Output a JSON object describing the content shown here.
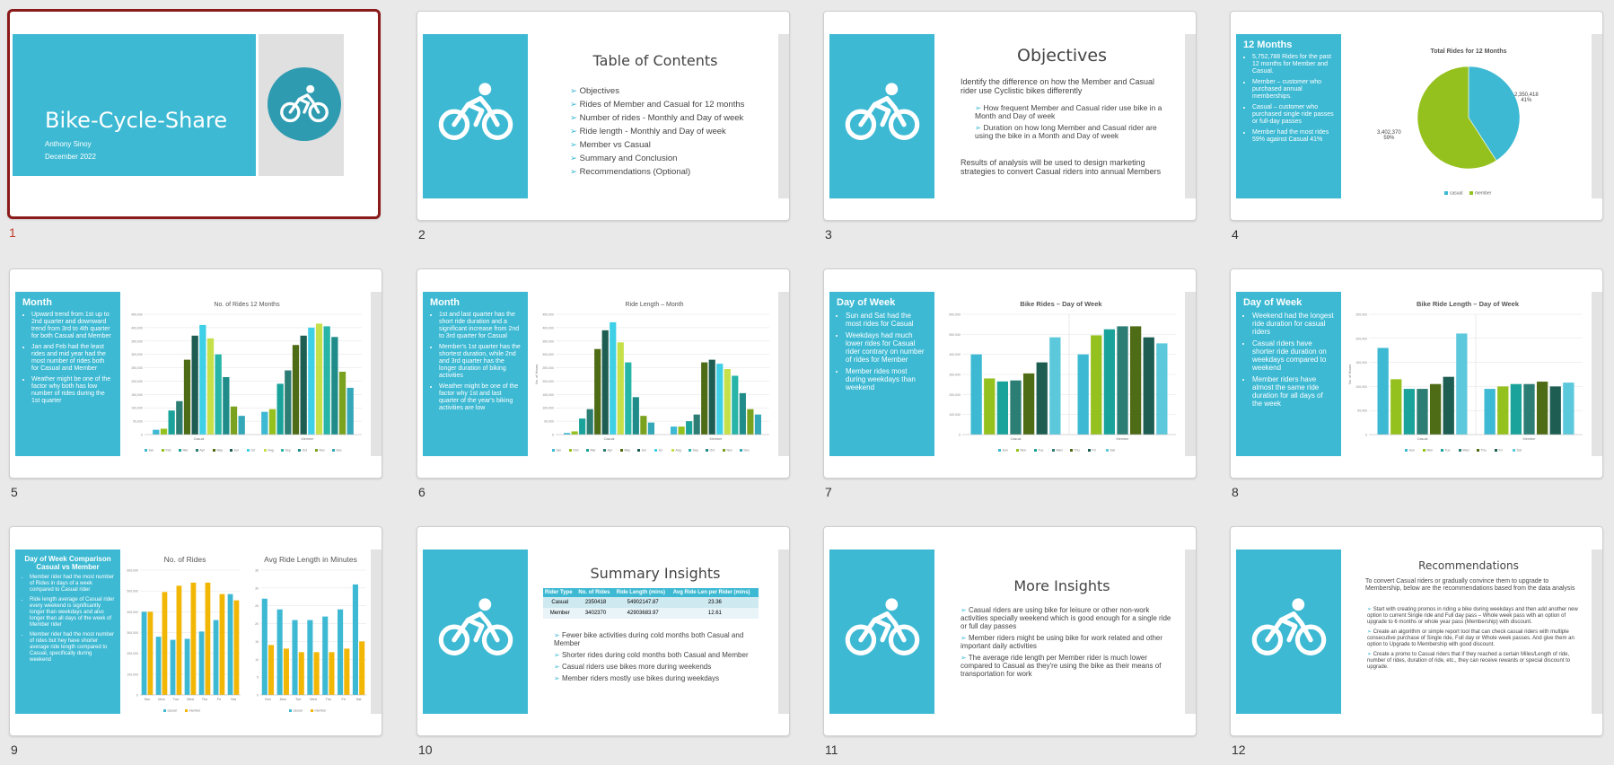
{
  "slide_numbers": [
    "1",
    "2",
    "3",
    "4",
    "5",
    "6",
    "7",
    "8",
    "9",
    "10",
    "11",
    "12"
  ],
  "slide1": {
    "title": "Bike-Cycle-Share",
    "author": "Anthony Sinoy",
    "date": "December 2022"
  },
  "slide2": {
    "title": "Table of Contents",
    "items": [
      "Objectives",
      "Rides of Member and Casual for 12 months",
      "Number of rides - Monthly and Day of week",
      "Ride length - Monthly and Day of week",
      "Member vs Casual",
      "Summary and Conclusion",
      "Recommendations (Optional)"
    ]
  },
  "slide3": {
    "title": "Objectives",
    "intro": "Identify the difference on how the Member and Casual rider use Cyclistic bikes differently",
    "bullets": [
      "How frequent Member and Casual rider use bike in a Month and Day of week",
      "Duration on how long Member and Casual rider are using the bike in a Month and Day of week"
    ],
    "outro": "Results of analysis will be used to design marketing strategies to convert Casual riders into annual Members"
  },
  "slide4": {
    "panel_title": "12 Months",
    "bullets": [
      "5,752,788 Rides for the past 12 months for Member and Casual.",
      "Member – customer who purchased annual memberships.",
      "Casual – customer who purchased single ride passes or full-day passes",
      "Member had the most rides 59% against Casual 41%"
    ],
    "label_casual_value": "2,350,418",
    "label_casual_pct": "41%",
    "label_member_value": "3,402,370",
    "label_member_pct": "59%"
  },
  "slide5": {
    "panel_title": "Month",
    "bullets": [
      "Upward trend from 1st up to 2nd quarter and downward trend from 3rd to 4th quarter for both Casual and Member",
      "Jan and Feb had the least rides and mid year had the most number of rides both for Casual and Member",
      "Weather might be one of the factor why both has low number of rides during the 1st quarter"
    ]
  },
  "slide6": {
    "panel_title": "Month",
    "bullets": [
      "1st and last quarter has the short ride duration and a significant increase from 2nd to 3rd quarter for Casual",
      "Member's 1st quarter has the shortest duration, while 2nd and 3rd quarter has the longer duration of biking activities",
      "Weather might be one of the factor why 1st and last quarter of the year's biking activities are low"
    ]
  },
  "slide7": {
    "panel_title": "Day of Week",
    "bullets": [
      "Sun and Sat had the most rides for Casual",
      "Weekdays had much lower rides for Casual rider contrary on number of rides for Member",
      "Member rides most during weekdays than weekend"
    ]
  },
  "slide8": {
    "panel_title": "Day of Week",
    "bullets": [
      "Weekend had the longest ride duration for casual riders",
      "Casual riders have shorter ride duration on weekdays compared to weekend",
      "Member riders have almost the same ride duration for all days of the week"
    ]
  },
  "slide9": {
    "panel_title": "Day of Week Comparison Casual vs Member",
    "bullets": [
      "Member rider had the most number of Rides in days of a week compared to Casual rider",
      "Ride length average of Casual rider every weekend is significantly longer than weekdays and also longer than all days of the week of Member rider",
      "Member rider had the most number of rides but hey have shorter average ride length compared to Casual, specifically during weekend"
    ]
  },
  "slide10": {
    "title": "Summary Insights",
    "table": {
      "headers": [
        "Rider Type",
        "No. of Rides",
        "Ride Length (mins)",
        "Avg Ride Len per Rider (mins)"
      ],
      "rows": [
        [
          "Casual",
          "2350418",
          "54902147.87",
          "23.36"
        ],
        [
          "Member",
          "3402370",
          "42903683.97",
          "12.61"
        ]
      ]
    },
    "bullets": [
      "Fewer bike activities during cold months both Casual and Member",
      "Shorter rides during cold months both Casual and Member",
      "Casual riders use bikes more during weekends",
      "Member riders mostly use bikes during weekdays"
    ]
  },
  "slide11": {
    "title": "More Insights",
    "bullets": [
      "Casual riders are using bike for leisure or other non-work activities specially weekend which is good enough for a single ride or full day passes",
      "Member riders might be using bike for work related and other important daily activities",
      "The average ride length per Member rider is much lower compared to Casual as they're using the bike as their means of transportation for work"
    ]
  },
  "slide12": {
    "title": "Recommendations",
    "intro": "To convert Casual riders or gradually convince them to upgrade to Membership, below are the recommendations based from the data analysis",
    "bullets": [
      "Start with creating promos in riding a bike during weekdays and then add another new option to current Single ride and Full day pass – Whole week pass with an option of upgrade to 6 months or whole year pass (Membership) with discount.",
      "Create an algorithm or simple report tool that can check casual riders with multiple consecutive purchase of Single ride, Full day or Whole week passes. And give them an option to Upgrade to Membership with good discount.",
      "Create a promo to Casual riders that if they reached a certain Miles/Length of ride, number of rides, duration of ride, etc., they can receive rewards or special discount to upgrade."
    ]
  },
  "colors": {
    "accent": "#3db9d3",
    "selected": "#8b1a1a",
    "casual": "#3db9d3",
    "member": "#95c11f"
  },
  "chart_data": [
    {
      "type": "pie",
      "title": "Total Rides for 12 Months",
      "categories": [
        "casual",
        "member"
      ],
      "values": [
        2350418,
        3402370
      ],
      "percent": [
        41,
        59
      ],
      "legend": "bottom"
    },
    {
      "type": "bar",
      "title": "No. of Rides 12 Months",
      "categories": [
        "Casual",
        "Member"
      ],
      "series": [
        {
          "name": "Jan",
          "values": [
            18000,
            85000
          ]
        },
        {
          "name": "Feb",
          "values": [
            22000,
            95000
          ]
        },
        {
          "name": "Mar",
          "values": [
            90000,
            190000
          ]
        },
        {
          "name": "Apr",
          "values": [
            125000,
            240000
          ]
        },
        {
          "name": "May",
          "values": [
            280000,
            335000
          ]
        },
        {
          "name": "Jun",
          "values": [
            370000,
            370000
          ]
        },
        {
          "name": "Jul",
          "values": [
            410000,
            400000
          ]
        },
        {
          "name": "Aug",
          "values": [
            360000,
            415000
          ]
        },
        {
          "name": "Sep",
          "values": [
            300000,
            405000
          ]
        },
        {
          "name": "Oct",
          "values": [
            215000,
            365000
          ]
        },
        {
          "name": "Nov",
          "values": [
            105000,
            235000
          ]
        },
        {
          "name": "Dec",
          "values": [
            70000,
            175000
          ]
        }
      ],
      "ylim": [
        0,
        450000
      ],
      "legend": "bottom"
    },
    {
      "type": "bar",
      "title": "Ride Length – Month",
      "ylabel": "No. of Hours",
      "categories": [
        "Casual",
        "Member"
      ],
      "series": [
        {
          "name": "Jan",
          "values": [
            6000,
            30000
          ]
        },
        {
          "name": "Feb",
          "values": [
            12000,
            30000
          ]
        },
        {
          "name": "Mar",
          "values": [
            60000,
            50000
          ]
        },
        {
          "name": "Apr",
          "values": [
            95000,
            75000
          ]
        },
        {
          "name": "May",
          "values": [
            320000,
            270000
          ]
        },
        {
          "name": "Jun",
          "values": [
            390000,
            280000
          ]
        },
        {
          "name": "Jul",
          "values": [
            420000,
            265000
          ]
        },
        {
          "name": "Aug",
          "values": [
            345000,
            245000
          ]
        },
        {
          "name": "Sep",
          "values": [
            270000,
            220000
          ]
        },
        {
          "name": "Oct",
          "values": [
            140000,
            155000
          ]
        },
        {
          "name": "Nov",
          "values": [
            70000,
            95000
          ]
        },
        {
          "name": "Dec",
          "values": [
            45000,
            75000
          ]
        }
      ],
      "ylim": [
        0,
        450000
      ],
      "legend": "bottom"
    },
    {
      "type": "bar",
      "title": "Bike Rides – Day of Week",
      "categories": [
        "Casual",
        "Member"
      ],
      "series": [
        {
          "name": "Sun",
          "values": [
            400000,
            400000
          ]
        },
        {
          "name": "Mon",
          "values": [
            280000,
            495000
          ]
        },
        {
          "name": "Tue",
          "values": [
            265000,
            525000
          ]
        },
        {
          "name": "Wed",
          "values": [
            270000,
            540000
          ]
        },
        {
          "name": "Thu",
          "values": [
            305000,
            540000
          ]
        },
        {
          "name": "Fri",
          "values": [
            360000,
            485000
          ]
        },
        {
          "name": "Sat",
          "values": [
            485000,
            455000
          ]
        }
      ],
      "ylim": [
        0,
        600000
      ],
      "legend": "bottom"
    },
    {
      "type": "bar",
      "title": "Bike Ride Length – Day of Week",
      "ylabel": "No. of Hours",
      "categories": [
        "Casual",
        "Member"
      ],
      "series": [
        {
          "name": "Sun",
          "values": [
            180000,
            95000
          ]
        },
        {
          "name": "Mon",
          "values": [
            115000,
            100000
          ]
        },
        {
          "name": "Tue",
          "values": [
            95000,
            105000
          ]
        },
        {
          "name": "Wed",
          "values": [
            95000,
            105000
          ]
        },
        {
          "name": "Thu",
          "values": [
            105000,
            110000
          ]
        },
        {
          "name": "Fri",
          "values": [
            120000,
            100000
          ]
        },
        {
          "name": "Sat",
          "values": [
            210000,
            108000
          ]
        }
      ],
      "ylim": [
        0,
        250000
      ],
      "legend": "bottom"
    },
    {
      "type": "bar",
      "title": "No. of Rides",
      "categories": [
        "Sun",
        "Mon",
        "Tue",
        "Wed",
        "Thu",
        "Fri",
        "Sat"
      ],
      "series": [
        {
          "name": "casual",
          "values": [
            400000,
            280000,
            265000,
            270000,
            305000,
            360000,
            485000
          ]
        },
        {
          "name": "member",
          "values": [
            400000,
            495000,
            525000,
            540000,
            540000,
            485000,
            455000
          ]
        }
      ],
      "ylim": [
        0,
        600000
      ],
      "legend": "bottom"
    },
    {
      "type": "bar",
      "title": "Avg Ride Length in Minutes",
      "categories": [
        "Sun",
        "Mon",
        "Tue",
        "Wed",
        "Thu",
        "Fri",
        "Sat"
      ],
      "series": [
        {
          "name": "casual",
          "values": [
            27,
            24,
            21,
            21,
            22,
            24,
            31
          ]
        },
        {
          "name": "member",
          "values": [
            14,
            13,
            12,
            12,
            12,
            13,
            15
          ]
        }
      ],
      "ylim": [
        0,
        35
      ],
      "legend": "bottom"
    }
  ]
}
